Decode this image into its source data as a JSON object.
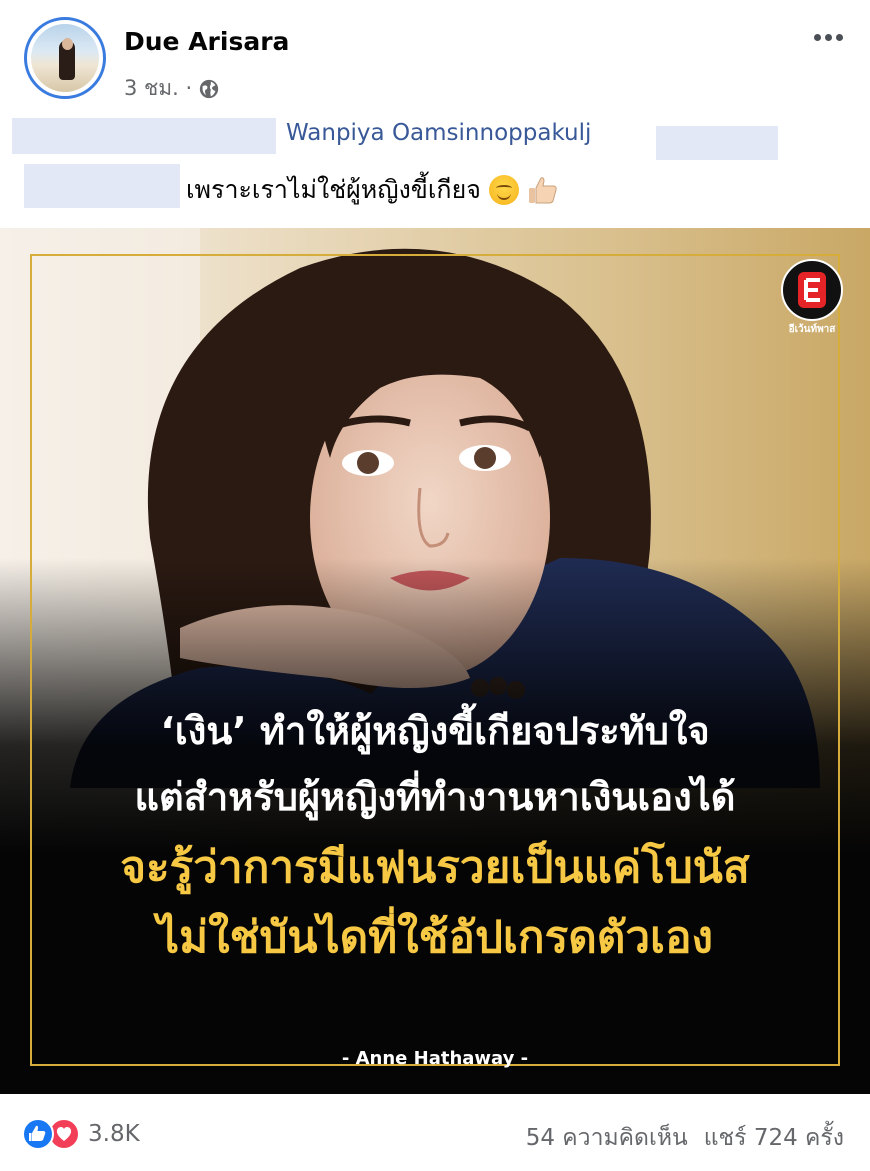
{
  "post": {
    "author": "Due Arisara",
    "time": "3 ชม. ·",
    "audience_icon": "globe-icon",
    "mention": "Wanpiya Oamsinnoppakulj",
    "caption": "เพราะเราไม่ใช่ผู้หญิงขี้เกียจ"
  },
  "image": {
    "logo_label": "อีเว้นท์พาส",
    "quote_line1": "‘เงิน’ ทำให้ผู้หญิงขี้เกียจประทับใจ",
    "quote_line2": "แต่สำหรับผู้หญิงที่ทำงานหาเงินเองได้",
    "quote_line3": "จะรู้ว่าการมีแฟนรวยเป็นแค่โบนัส",
    "quote_line4": "ไม่ใช่บันไดที่ใช้อัปเกรดตัวเอง",
    "attribution": "- Anne Hathaway -"
  },
  "footer": {
    "reaction_count": "3.8K",
    "comments": "54 ความคิดเห็น",
    "shares": "แชร์ 724 ครั้ง"
  },
  "colors": {
    "link": "#385898",
    "quote_white": "#ffffff",
    "quote_yellow": "#f7c843",
    "frame_gold": "#d6ad3a",
    "like_blue": "#1877f2",
    "love_red": "#f33e58"
  }
}
